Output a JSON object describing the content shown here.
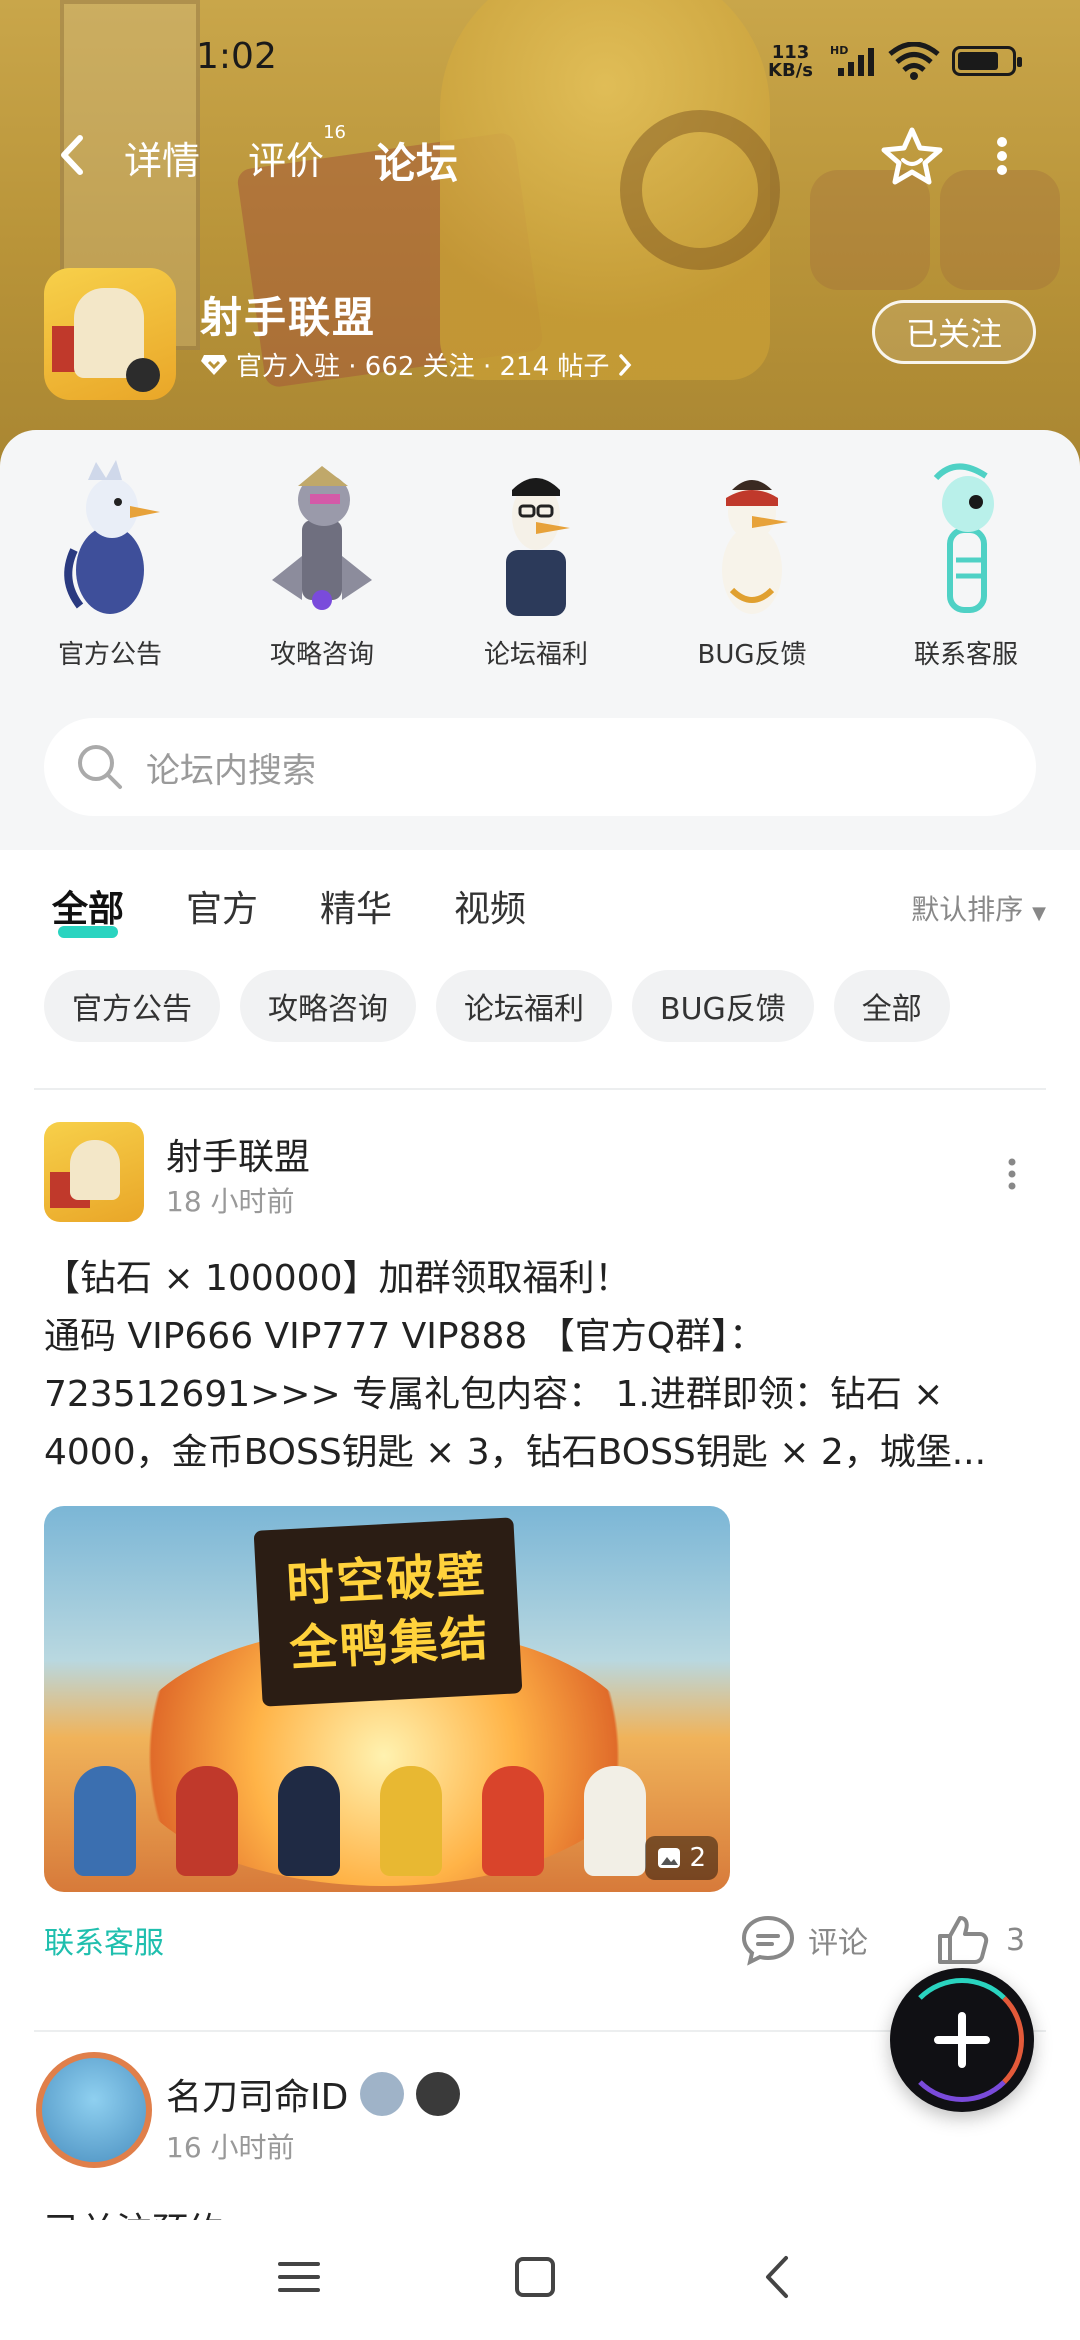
{
  "status": {
    "time": "1:02",
    "net_speed": "113",
    "net_unit": "KB/s",
    "hd": "HD"
  },
  "nav": {
    "tabs": [
      {
        "label": "详情"
      },
      {
        "label": "评价",
        "badge": "16"
      },
      {
        "label": "论坛"
      }
    ]
  },
  "game": {
    "title": "射手联盟",
    "meta": "官方入驻 · 662 关注 · 214 帖子",
    "follow_label": "已关注"
  },
  "categories": [
    {
      "label": "官方公告",
      "color": "#4a6fb0"
    },
    {
      "label": "攻略咨询",
      "color": "#7f7f8f"
    },
    {
      "label": "论坛福利",
      "color": "#2c3a5a"
    },
    {
      "label": "BUG反馈",
      "color": "#c0392b"
    },
    {
      "label": "联系客服",
      "color": "#4fd1c5"
    }
  ],
  "search": {
    "placeholder": "论坛内搜索"
  },
  "filters": {
    "tabs": [
      "全部",
      "官方",
      "精华",
      "视频"
    ],
    "sort_label": "默认排序"
  },
  "chips": [
    "官方公告",
    "攻略咨询",
    "论坛福利",
    "BUG反馈",
    "全部"
  ],
  "post": {
    "author": "射手联盟",
    "time": "18 小时前",
    "title": "【钻石 × 100000】加群领取福利！",
    "body_line1": "通码 VIP666 VIP777 VIP888 【官方Q群】：",
    "body_line2": "723512691>>> 专属礼包内容： 1.进群即领：钻石 ×",
    "body_line3": "4000，金币BOSS钥匙 × 3，钻石BOSS钥匙 × 2，城堡...",
    "image_text_line1": "时空破壁",
    "image_text_line2": "全鸭集结",
    "image_count": "2",
    "tag": "联系客服",
    "comment_label": "评论",
    "like_count": "3"
  },
  "post2": {
    "author": "名刀司命ID",
    "time": "16 小时前",
    "text": "已关注预约"
  }
}
